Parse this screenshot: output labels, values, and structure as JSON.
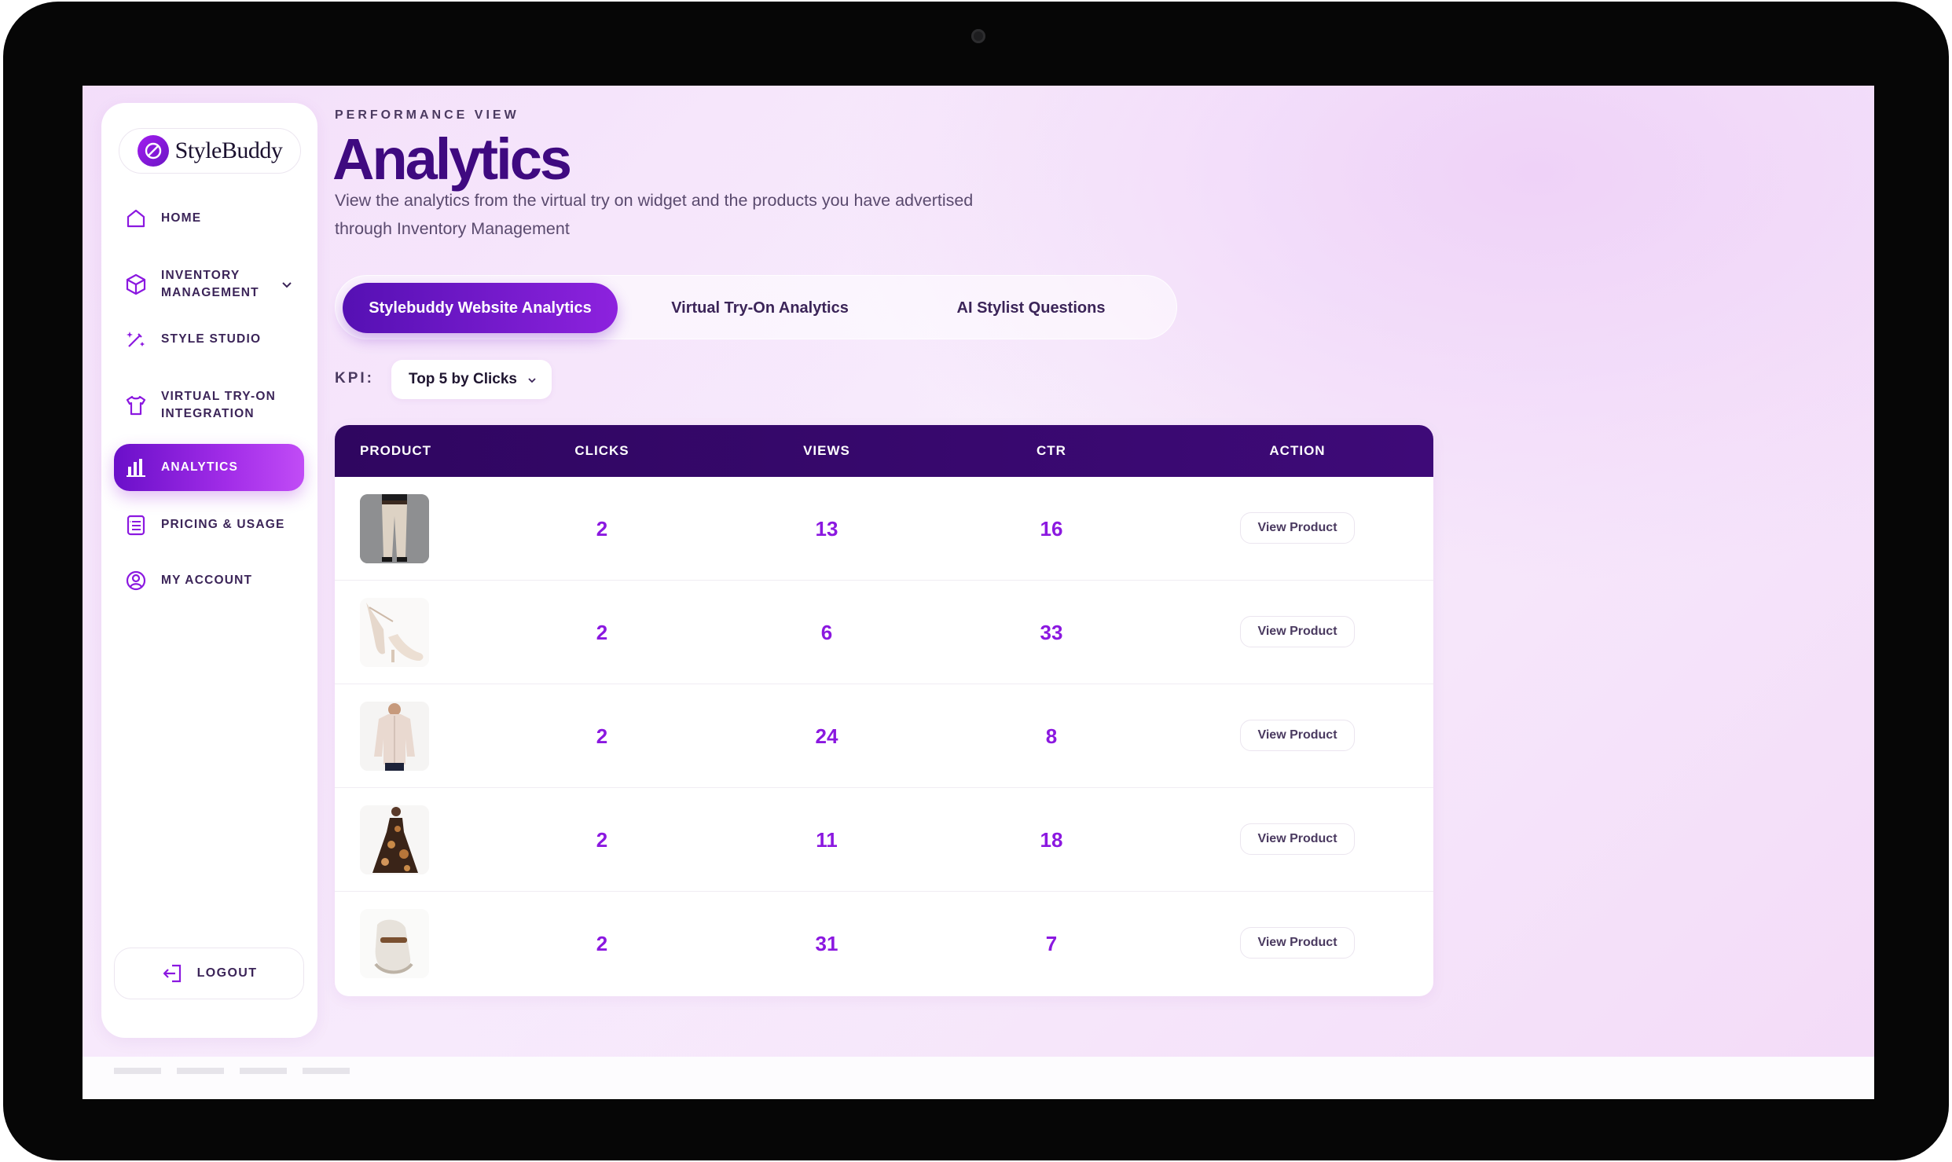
{
  "app": {
    "brand": "StyleBuddy"
  },
  "sidebar": {
    "items": [
      {
        "label": "HOME",
        "icon": "home-icon"
      },
      {
        "label": "INVENTORY MANAGEMENT",
        "icon": "box-icon"
      },
      {
        "label": "STYLE STUDIO",
        "icon": "magic-wand-icon"
      },
      {
        "label": "VIRTUAL TRY-ON INTEGRATION",
        "icon": "shirt-icon"
      },
      {
        "label": "ANALYTICS",
        "icon": "bar-chart-icon",
        "active": true
      },
      {
        "label": "PRICING & USAGE",
        "icon": "receipt-icon"
      },
      {
        "label": "MY ACCOUNT",
        "icon": "user-circle-icon"
      }
    ],
    "logout_label": "LOGOUT"
  },
  "header": {
    "eyebrow": "PERFORMANCE VIEW",
    "title": "Analytics",
    "subtitle": "View the analytics from the virtual try on widget and the products you have advertised through Inventory Management"
  },
  "tabs": [
    {
      "label": "Stylebuddy Website Analytics",
      "active": true
    },
    {
      "label": "Virtual Try-On Analytics",
      "active": false
    },
    {
      "label": "AI Stylist Questions",
      "active": false
    }
  ],
  "kpi": {
    "label": "KPI:",
    "selected": "Top 5 by Clicks"
  },
  "table": {
    "columns": [
      "PRODUCT",
      "CLICKS",
      "VIEWS",
      "CTR",
      "ACTION"
    ],
    "rows": [
      {
        "product": "trousers",
        "clicks": "2",
        "views": "13",
        "ctr": "16",
        "action": "View Product"
      },
      {
        "product": "heels",
        "clicks": "2",
        "views": "6",
        "ctr": "33",
        "action": "View Product"
      },
      {
        "product": "shirt",
        "clicks": "2",
        "views": "24",
        "ctr": "8",
        "action": "View Product"
      },
      {
        "product": "floral-dress",
        "clicks": "2",
        "views": "11",
        "ctr": "18",
        "action": "View Product"
      },
      {
        "product": "loafers",
        "clicks": "2",
        "views": "31",
        "ctr": "7",
        "action": "View Product"
      }
    ]
  },
  "colors": {
    "accent": "#8b18e0",
    "header_dark": "#3f0a80",
    "table_header": "#2f0660"
  }
}
